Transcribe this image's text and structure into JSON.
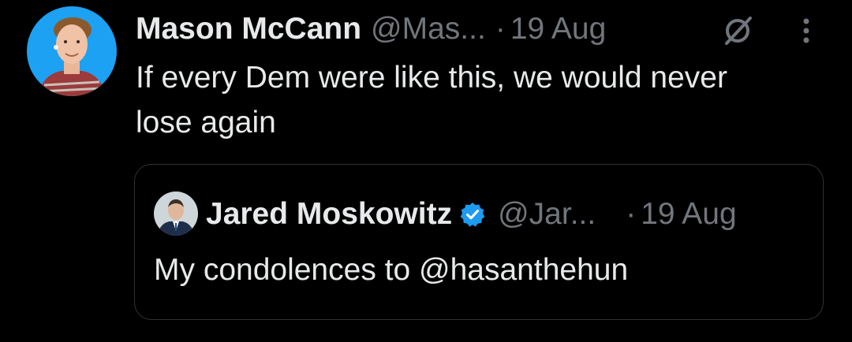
{
  "colors": {
    "background": "#000000",
    "primary_text": "#e7e9ea",
    "secondary_text": "#71767b",
    "border": "#2f3336",
    "verified_blue": "#1d9bf0",
    "avatar_bg": "#1da1f2"
  },
  "tweet": {
    "author_name": "Mason McCann",
    "author_handle": "@Mas...",
    "separator": "·",
    "date": "19 Aug",
    "text": "If every Dem were like this, we would never lose again",
    "icons": {
      "grok": "grok-icon",
      "more": "more-vertical-icon"
    }
  },
  "quoted_tweet": {
    "author_name": "Jared Moskowitz",
    "verified": true,
    "verified_icon": "verified-badge-icon",
    "author_handle": "@Jar...",
    "separator": "·",
    "date": "19 Aug",
    "text": "My condolences to @hasanthehun"
  }
}
